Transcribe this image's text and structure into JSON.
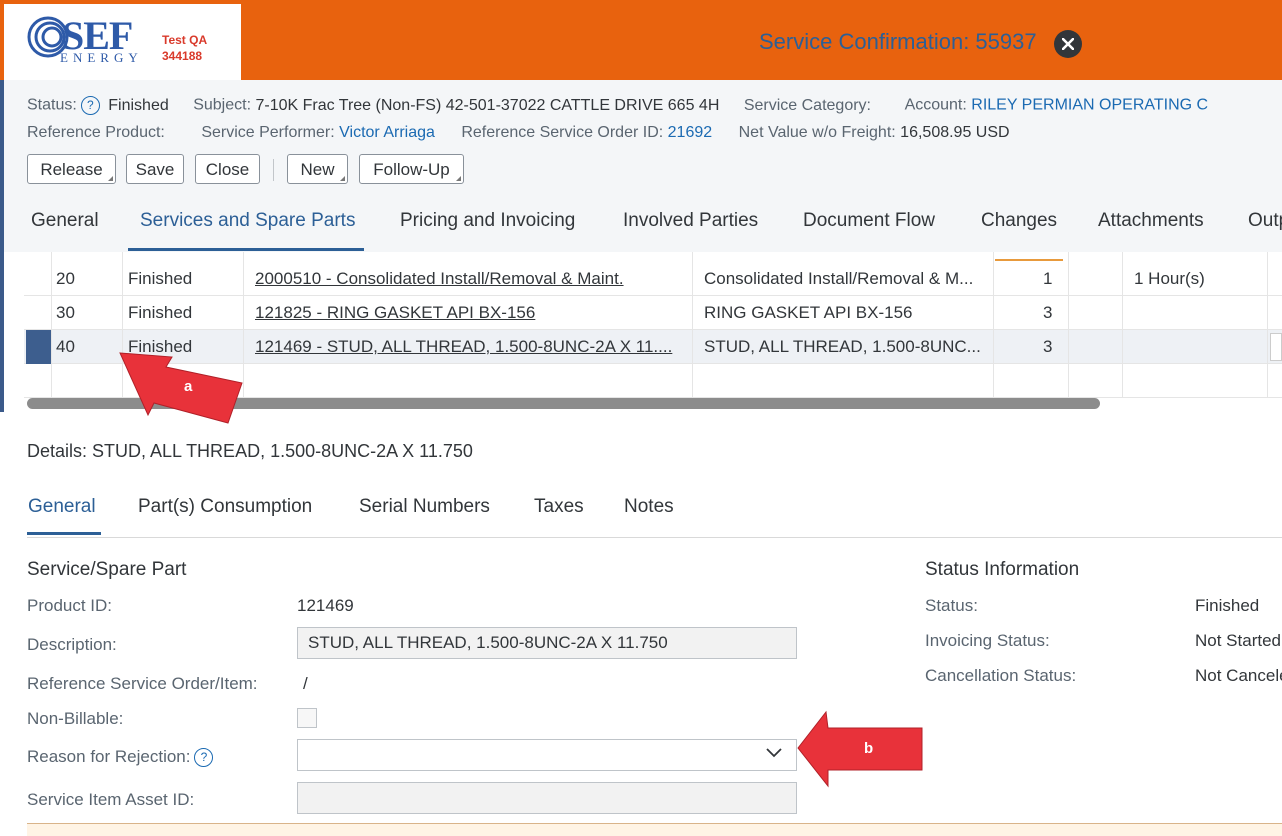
{
  "header": {
    "logo_text": "SEF",
    "logo_subtext": "ENERGY",
    "env_line1": "Test QA",
    "env_line2": "344188",
    "title": "Service Confirmation: 55937"
  },
  "info": {
    "status_label": "Status:",
    "status_value": "Finished",
    "subject_label": "Subject:",
    "subject_value": "7-10K Frac Tree (Non-FS)  42-501-37022 CATTLE DRIVE 665 4H",
    "service_category_label": "Service Category:",
    "account_label": "Account:",
    "account_value": "RILEY PERMIAN OPERATING C",
    "reference_product_label": "Reference Product:",
    "service_performer_label": "Service Performer:",
    "service_performer_value": "Victor Arriaga",
    "ref_service_order_label": "Reference Service Order ID:",
    "ref_service_order_value": "21692",
    "net_value_label": "Net Value w/o Freight:",
    "net_value_value": "16,508.95 USD"
  },
  "toolbar": {
    "release": "Release",
    "save": "Save",
    "close": "Close",
    "new": "New",
    "follow_up": "Follow-Up"
  },
  "tabs": [
    "General",
    "Services and Spare Parts",
    "Pricing and Invoicing",
    "Involved Parties",
    "Document Flow",
    "Changes",
    "Attachments",
    "Outp"
  ],
  "items": [
    {
      "no": "20",
      "status": "Finished",
      "product": "2000510 - Consolidated Install/Removal & Maint.",
      "description": "Consolidated Install/Removal & M...",
      "qty": "1",
      "unit": "1 Hour(s)"
    },
    {
      "no": "30",
      "status": "Finished",
      "product": "121825 - RING GASKET API BX-156",
      "description": "RING GASKET API BX-156",
      "qty": "3",
      "unit": ""
    },
    {
      "no": "40",
      "status": "Finished",
      "product": "121469 - STUD, ALL THREAD, 1.500-8UNC-2A X 11....",
      "description": "STUD, ALL THREAD, 1.500-8UNC...",
      "qty": "3",
      "unit": ""
    }
  ],
  "details": {
    "title": "Details: STUD, ALL THREAD, 1.500-8UNC-2A X 11.750",
    "subtabs": [
      "General",
      "Part(s) Consumption",
      "Serial Numbers",
      "Taxes",
      "Notes"
    ],
    "section_title": "Service/Spare Part",
    "product_id_label": "Product ID:",
    "product_id_value": "121469",
    "description_label": "Description:",
    "description_value": "STUD, ALL THREAD, 1.500-8UNC-2A X 11.750",
    "ref_order_item_label": "Reference Service Order/Item:",
    "ref_order_item_value": "/",
    "non_billable_label": "Non-Billable:",
    "reason_rejection_label": "Reason for Rejection:",
    "reason_rejection_value": "",
    "asset_id_label": "Service Item Asset ID:",
    "asset_id_value": ""
  },
  "status_info": {
    "title": "Status Information",
    "status_label": "Status:",
    "status_value": "Finished",
    "invoicing_label": "Invoicing Status:",
    "invoicing_value": "Not Started",
    "cancellation_label": "Cancellation Status:",
    "cancellation_value": "Not Cancele"
  },
  "annotations": {
    "a": "a",
    "b": "b"
  },
  "colors": {
    "accent_orange": "#e8620e",
    "link_blue": "#1b6ab2",
    "annotation_red": "#e8323a"
  }
}
